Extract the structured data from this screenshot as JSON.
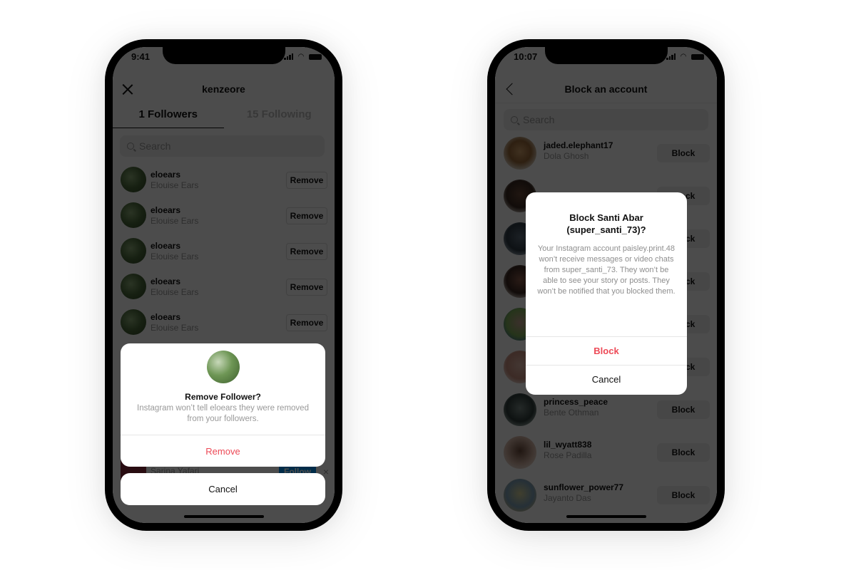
{
  "left_phone": {
    "status_time": "9:41",
    "nav_title": "kenzeore",
    "close_icon": "close-icon",
    "tabs": [
      {
        "label": "1 Followers",
        "active": true
      },
      {
        "label": "15 Following",
        "active": false
      }
    ],
    "search_placeholder": "Search",
    "followers": [
      {
        "username": "eloears",
        "full_name": "Elouise Ears",
        "action": "Remove"
      },
      {
        "username": "eloears",
        "full_name": "Elouise Ears",
        "action": "Remove"
      },
      {
        "username": "eloears",
        "full_name": "Elouise Ears",
        "action": "Remove"
      },
      {
        "username": "eloears",
        "full_name": "Elouise Ears",
        "action": "Remove"
      },
      {
        "username": "eloears",
        "full_name": "Elouise Ears",
        "action": "Remove"
      }
    ],
    "hidden_row": {
      "full_name": "Sarina Yafari",
      "action": "Follow",
      "dismiss": "×"
    },
    "sheet": {
      "title": "Remove Follower?",
      "body": "Instagram won’t tell eloears they were removed from your followers.",
      "remove_label": "Remove",
      "cancel_label": "Cancel"
    }
  },
  "right_phone": {
    "status_time": "10:07",
    "nav_title": "Block an account",
    "back_icon": "chevron-left-icon",
    "search_placeholder": "Search",
    "accounts": [
      {
        "username": "jaded.elephant17",
        "full_name": "Dola Ghosh",
        "action": "Block"
      },
      {
        "username": "",
        "full_name": "",
        "action": "Block"
      },
      {
        "username": "",
        "full_name": "",
        "action": "Block"
      },
      {
        "username": "",
        "full_name": "",
        "action": "Block"
      },
      {
        "username": "",
        "full_name": "",
        "action": "Block"
      },
      {
        "username": "",
        "full_name": "",
        "action": "Block"
      },
      {
        "username": "princess_peace",
        "full_name": "Bente Othman",
        "action": "Block"
      },
      {
        "username": "lil_wyatt838",
        "full_name": "Rose Padilla",
        "action": "Block"
      },
      {
        "username": "sunflower_power77",
        "full_name": "Jayanto Das",
        "action": "Block"
      }
    ],
    "alert": {
      "title": "Block Santi Abar (super_santi_73)?",
      "body": "Your Instagram account paisley.print.48 won’t receive messages or video chats from super_santi_73. They won’t be able to see your story or posts. They won’t be notified that you blocked them.",
      "block_label": "Block",
      "cancel_label": "Cancel"
    }
  },
  "colors": {
    "destructive": "#ed4956",
    "follow_blue": "#0095f6",
    "overlay": "rgba(0,0,0,0.70)"
  }
}
